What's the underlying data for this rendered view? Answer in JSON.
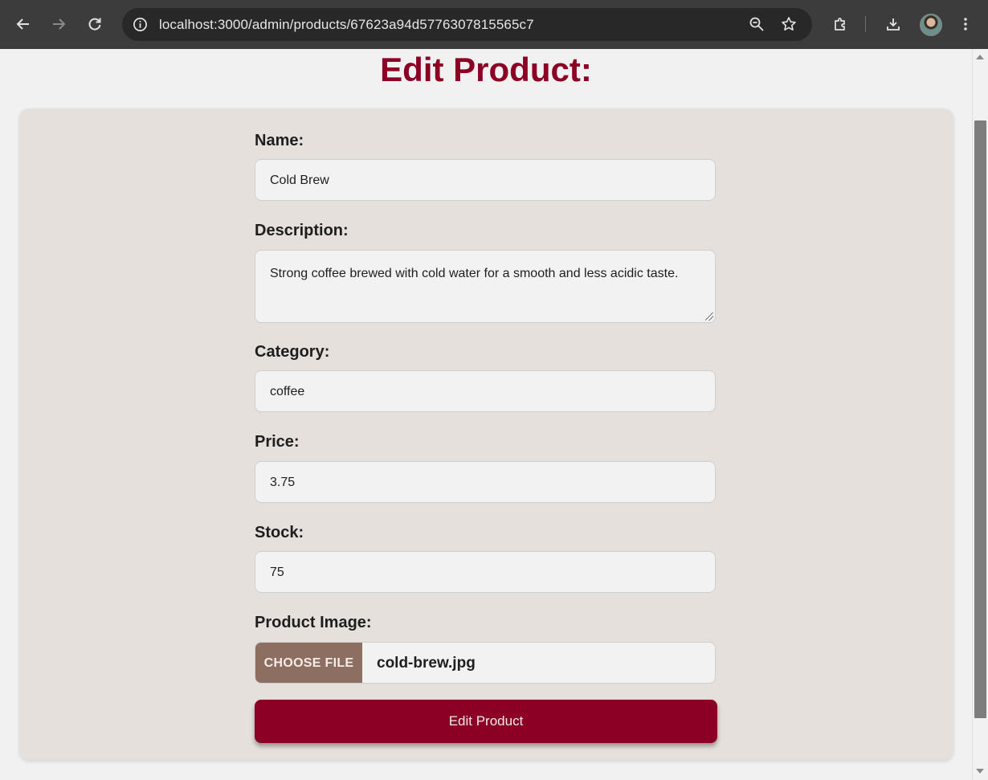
{
  "browser": {
    "url": "localhost:3000/admin/products/67623a94d5776307815565c7"
  },
  "page": {
    "title": "Edit Product:"
  },
  "form": {
    "name_label": "Name:",
    "name_value": "Cold Brew",
    "description_label": "Description:",
    "description_value": "Strong coffee brewed with cold water for a smooth and less acidic taste.",
    "category_label": "Category:",
    "category_value": "coffee",
    "price_label": "Price:",
    "price_value": "3.75",
    "stock_label": "Stock:",
    "stock_value": "75",
    "image_label": "Product Image:",
    "choose_file_label": "CHOOSE FILE",
    "file_name": "cold-brew.jpg",
    "submit_label": "Edit Product"
  },
  "colors": {
    "accent": "#8b0024",
    "card_bg": "#e6e0dc",
    "file_button": "#8c6f61",
    "toolbar": "#3c3c3c"
  },
  "icons": [
    "back-arrow-icon",
    "forward-arrow-icon",
    "reload-icon",
    "site-info-icon",
    "zoom-icon",
    "bookmark-star-icon",
    "extensions-icon",
    "download-icon",
    "profile-avatar",
    "menu-dots-icon"
  ]
}
